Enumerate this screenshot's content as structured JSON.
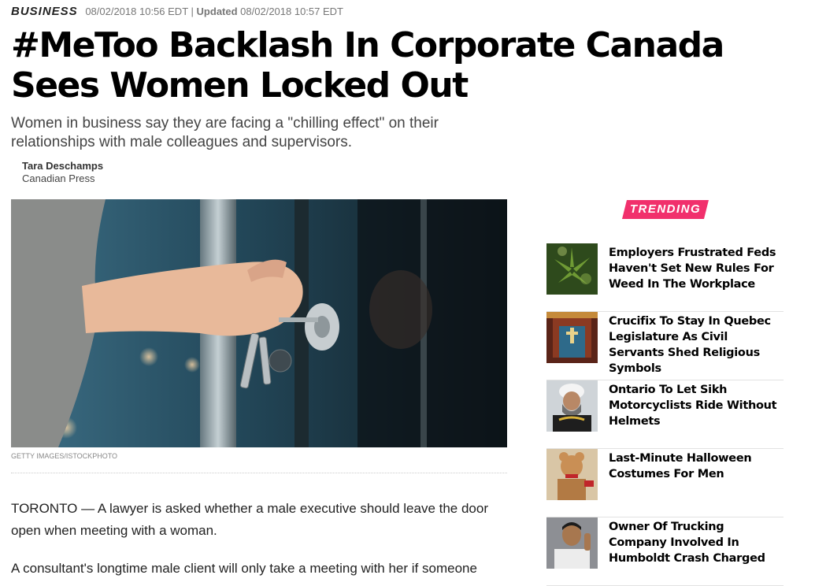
{
  "article": {
    "section": "BUSINESS",
    "published": "08/02/2018 10:56 EDT",
    "separator": "|",
    "updated_label": "Updated",
    "updated": "08/02/2018 10:57 EDT",
    "headline": "#MeToo Backlash In Corporate Canada Sees Women Locked Out",
    "dek": "Women in business say they are facing a \"chilling effect\" on their relationships with male colleagues and supervisors.",
    "author": "Tara Deschamps",
    "organization": "Canadian Press",
    "image_credit": "GETTY IMAGES/ISTOCKPHOTO",
    "paragraphs": [
      "TORONTO — A lawyer is asked whether a male executive should leave the door open when meeting with a woman.",
      "A consultant's longtime male client will only take a meeting with her if someone"
    ]
  },
  "trending": {
    "label": "TRENDING",
    "accent_color": "#f1306c",
    "items": [
      {
        "title": "Employers Frustrated Feds Haven't Set New Rules For Weed In The Workplace"
      },
      {
        "title": "Crucifix To Stay In Quebec Legislature As Civil Servants Shed Religious Symbols"
      },
      {
        "title": "Ontario To Let Sikh Motorcyclists Ride Without Helmets"
      },
      {
        "title": "Last-Minute Halloween Costumes For Men"
      },
      {
        "title": "Owner Of Trucking Company Involved In Humboldt Crash Charged"
      }
    ]
  }
}
